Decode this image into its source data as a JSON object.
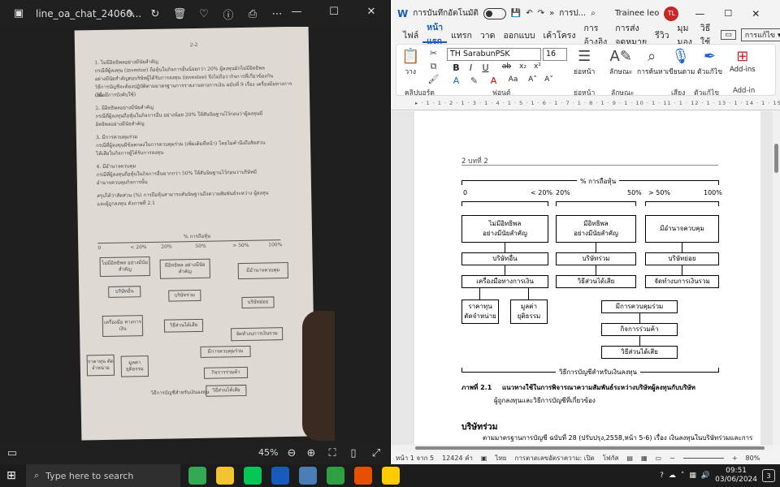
{
  "photos": {
    "file_name": "line_oa_chat_24060...",
    "zoom": "45%",
    "page": {
      "page_num": "2-2",
      "paragraphs": [
        "1. ไม่มีอิทธิพลอย่างมีนัยสำคัญ",
        "กรณีที่ผู้ลงทุน (investor) ถือหุ้นในกิจการอื่นน้อยกว่า 20% ผู้ลงทุนมักไม่มีอิทธิพล",
        "อย่างมีนัยสำคัญต่อบริษัทผู้ได้รับการลงทุน (investee) จึงไม่ถือว่ากิจการที่เกี่ยวข้องกัน",
        "วิธีการบัญชีจะต้องปฏิบัติตามมาตรฐานการรายงานทางการเงิน ฉบับที่ 9 เรื่อง เครื่องมือทางการเงิน",
        "(เมื่อมีการบังคับใช้)",
        "2. มีอิทธิพลอย่างมีนัยสำคัญ",
        "กรณีที่ผู้ลงทุนถือหุ้นในกิจการอื่น อย่างน้อย 20% ให้สันนิษฐานไว้ก่อนว่าผู้ลงทุนมี",
        "อิทธิพลอย่างมีนัยสำคัญ",
        "3. มีการควบคุมร่วม",
        "กรณีที่ผู้ลงทุนมีข้อตกลงในการควบคุมร่วม (เพิ่มเติมที่หน้า) โดยไม่คำนึงถึงสัดส่วน",
        "ได้เสียในกิจการผู้ได้รับการลงทุน",
        "4. มีอำนาจควบคุม",
        "กรณีที่ผู้ลงทุนถือหุ้นในกิจการอื่นมากกว่า 50% ให้สันนิษฐานไว้ก่อนว่าบริษัทมี",
        "อำนาจควบคุมกิจการนั้น",
        "สรุปได้ว่าสัดส่วน (%) การถือหุ้นสามารถสันนิษฐานถึงความสัมพันธ์ระหว่าง ผู้ลงทุน",
        "และผู้ถูกลงทุน ดังภาพที่ 2.1"
      ],
      "diagram_title": "% การถือหุ้น",
      "ticks": [
        "0",
        "< 20%",
        "20%",
        "50%",
        "> 50%",
        "100%"
      ],
      "boxes": [
        "ไม่มีอิทธิพล อย่างมีนัยสำคัญ",
        "มีอิทธิพล อย่างมีนัยสำคัญ",
        "มีอำนาจควบคุม",
        "บริษัทอื่น",
        "บริษัทร่วม",
        "บริษัทย่อย",
        "เครื่องมือ ทางการเงิน",
        "วิธีส่วนได้เสีย",
        "จัดทำงบการเงินรวม",
        "ราคาทุน ตัดจำหน่าย",
        "มูลค่า ยุติธรรม",
        "มีการควบคุมร่วม",
        "กิจการร่วมค้า",
        "วิธีส่วนได้เสีย"
      ],
      "footer": "วิธีการบัญชีสำหรับเงินลงทุน"
    }
  },
  "word": {
    "autosave_label": "การบันทึกอัตโนมัติ",
    "doc_title": "การป...",
    "user_name": "Trainee leo",
    "user_initials": "TL",
    "tabs": [
      "ไฟล์",
      "หน้าแรก",
      "แทรก",
      "วาด",
      "ออกแบบ",
      "เค้าโครง",
      "การอ้างอิง",
      "การส่งจดหมาย",
      "รีวิว",
      "มุมมอง",
      "วิธีใช้"
    ],
    "editing_label": "การแก้ไข",
    "font_name": "TH SarabunPSK",
    "font_size": "16",
    "ribbon": {
      "paste": "วาง",
      "clipboard": "คลิปบอร์ด",
      "font_group": "ฟอนต์",
      "paragraph": "ย่อหน้า",
      "styles": "ลักษณะ",
      "styles_group": "ลักษณะ",
      "find": "การค้นหา",
      "find_sub": "การแก้ไข",
      "dictate": "เขียนตาม",
      "voice_group": "เสียง",
      "editor": "ตัวแก้ไข",
      "editor_group": "ตัวแก้ไข",
      "addins": "Add-ins",
      "addins_group": "Add-in"
    },
    "page": {
      "header_text": "2  บทที่ 2",
      "diagram_title": "% การถือหุ้น",
      "ticks": [
        "0",
        "< 20%",
        "20%",
        "50%",
        "> 50%",
        "100%"
      ],
      "top_boxes": [
        "ไม่มีอิทธิพล\nอย่างมีนัยสำคัญ",
        "มีอิทธิพล\nอย่างมีนัยสำคัญ",
        "มีอำนาจควบคุม"
      ],
      "second_boxes": [
        "บริษัทอื่น",
        "บริษัทร่วม",
        "บริษัทย่อย"
      ],
      "third_boxes": [
        "เครื่องมือทางการเงิน",
        "วิธีส่วนได้เสีย",
        "จัดทำงบการเงินรวม"
      ],
      "fourth_left": [
        "ราคาทุน\nตัดจำหน่าย",
        "มูลค่า\nยุติธรรม"
      ],
      "joint_boxes": [
        "มีการควบคุมร่วม",
        "กิจการร่วมค้า",
        "วิธีส่วนได้เสีย"
      ],
      "footer_label": "วิธีการบัญชีสำหรับเงินลงทุน",
      "caption_num": "ภาพที่ 2.1",
      "caption_text": "แนวทางใช้ในการพิจารณาความสัมพันธ์ระหว่างบริษัทผู้ลงทุนกับบริษัท",
      "caption_text2": "ผู้ถูกลงทุนและวิธีการบัญชีที่เกี่ยวข้อง",
      "heading": "บริษัทร่วม",
      "body": "ตามมาตรฐานการบัญชี ฉบับที่ 28 (ปรับปรุง,2558,หน้า 5-6) เรื่อง เงินลงทุนในบริษัทร่วมและการ"
    },
    "status": {
      "page": "หน้า 1 จาก 5",
      "words": "12424 คำ",
      "lang": "ไทย",
      "accessibility": "การตาดเลขอัตราความ: เปิด",
      "focus": "โฟกัส",
      "zoom": "80%"
    }
  },
  "taskbar": {
    "search_placeholder": "Type here to search",
    "time": "09:51",
    "date": "03/06/2024",
    "notif_count": "3"
  }
}
